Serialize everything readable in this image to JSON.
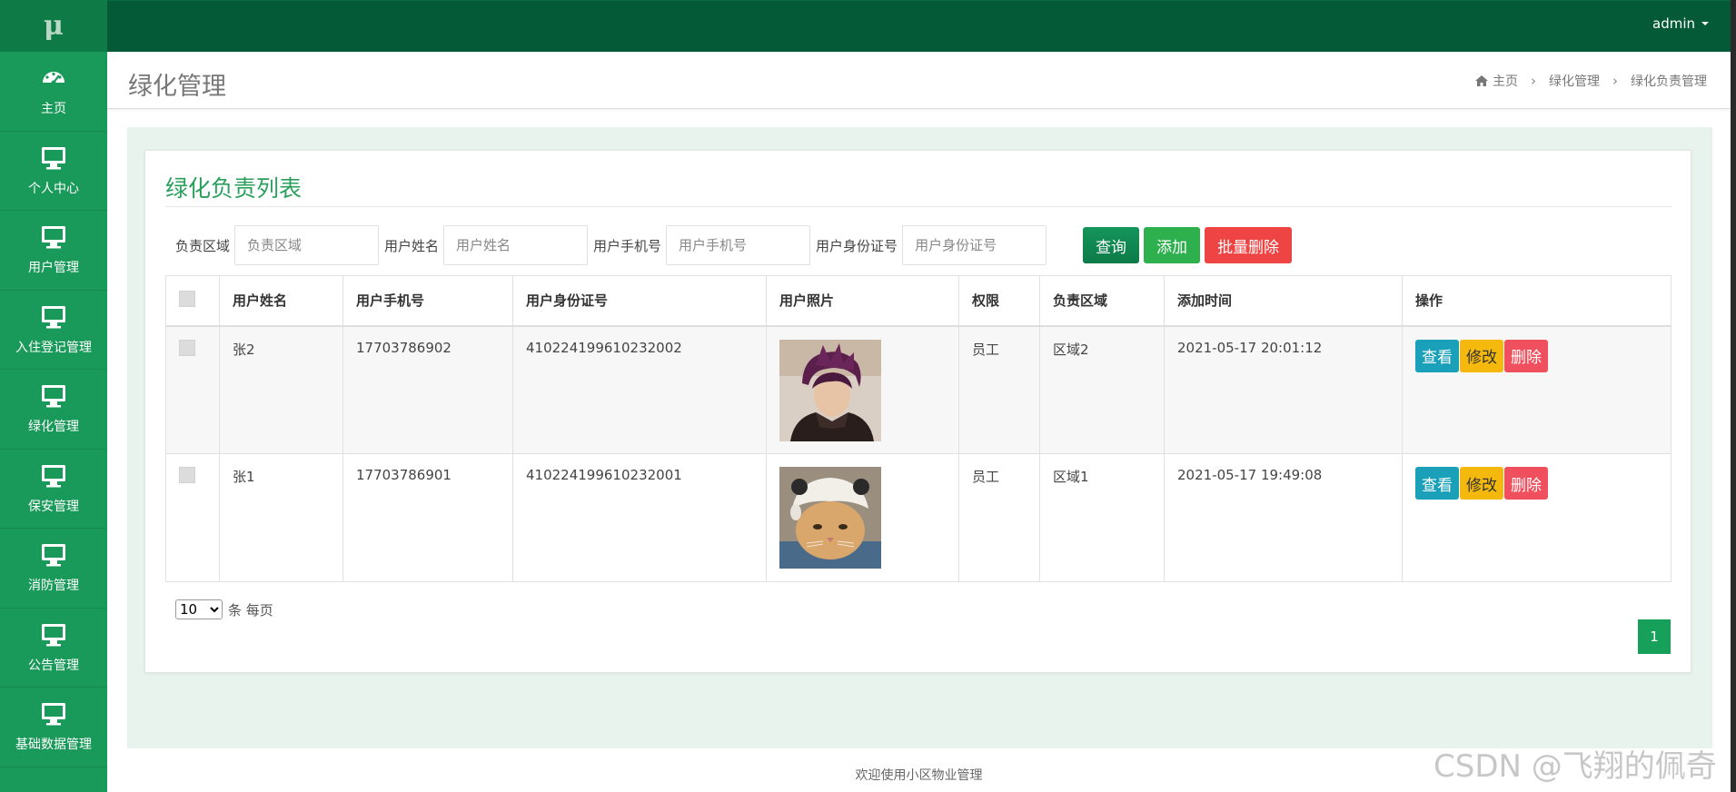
{
  "sidebar": {
    "logo": "μ",
    "items": [
      {
        "label": "主页",
        "icon": "dashboard-icon"
      },
      {
        "label": "个人中心",
        "icon": "monitor-icon"
      },
      {
        "label": "用户管理",
        "icon": "monitor-icon"
      },
      {
        "label": "入住登记管理",
        "icon": "monitor-icon"
      },
      {
        "label": "绿化管理",
        "icon": "monitor-icon"
      },
      {
        "label": "保安管理",
        "icon": "monitor-icon"
      },
      {
        "label": "消防管理",
        "icon": "monitor-icon"
      },
      {
        "label": "公告管理",
        "icon": "monitor-icon"
      },
      {
        "label": "基础数据管理",
        "icon": "monitor-icon"
      }
    ]
  },
  "topbar": {
    "user": "admin"
  },
  "header": {
    "title": "绿化管理",
    "breadcrumb": [
      "主页",
      "绿化管理",
      "绿化负责管理"
    ]
  },
  "card": {
    "title": "绿化负责列表"
  },
  "search": {
    "fields": [
      {
        "label": "负责区域",
        "placeholder": "负责区域"
      },
      {
        "label": "用户姓名",
        "placeholder": "用户姓名"
      },
      {
        "label": "用户手机号",
        "placeholder": "用户手机号"
      },
      {
        "label": "用户身份证号",
        "placeholder": "用户身份证号"
      }
    ],
    "buttons": {
      "query": "查询",
      "add": "添加",
      "batch_delete": "批量删除"
    }
  },
  "table": {
    "headers": [
      "用户姓名",
      "用户手机号",
      "用户身份证号",
      "用户照片",
      "权限",
      "负责区域",
      "添加时间",
      "操作"
    ],
    "rows": [
      {
        "name": "张2",
        "phone": "17703786902",
        "id_card": "410224199610232002",
        "role": "员工",
        "area": "区域2",
        "time": "2021-05-17 20:01:12"
      },
      {
        "name": "张1",
        "phone": "17703786901",
        "id_card": "410224199610232001",
        "role": "员工",
        "area": "区域1",
        "time": "2021-05-17 19:49:08"
      }
    ],
    "actions": {
      "view": "查看",
      "edit": "修改",
      "delete": "删除"
    }
  },
  "pagination": {
    "per_page_value": "10",
    "per_page_suffix": "条 每页",
    "current_page": "1"
  },
  "footer": {
    "text": "欢迎使用小区物业管理"
  },
  "watermark": "CSDN @飞翔的佩奇"
}
